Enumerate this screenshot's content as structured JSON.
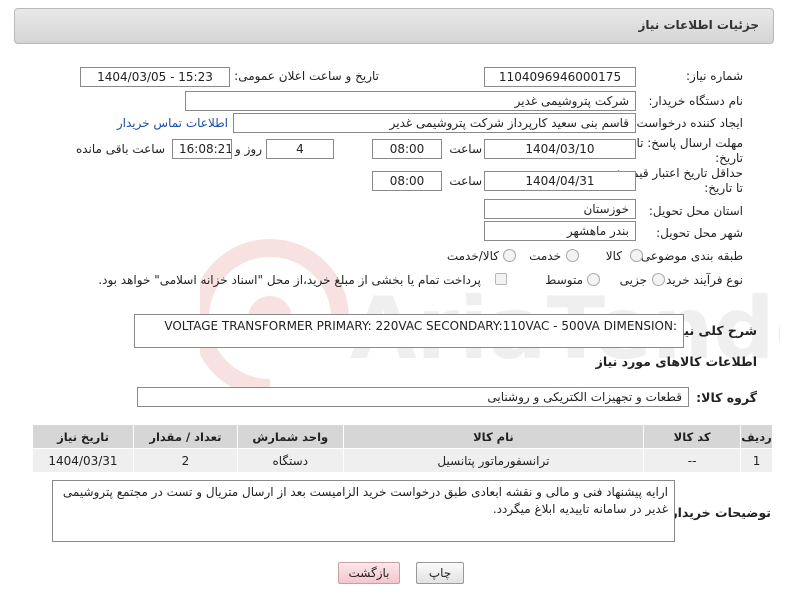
{
  "header": {
    "title": "جزئیات اطلاعات نیاز"
  },
  "form": {
    "need_number": {
      "label": "شماره نیاز:",
      "value": "1104096946000175"
    },
    "announce_datetime": {
      "label": "تاریخ و ساعت اعلان عمومی:",
      "value": "1404/03/05 - 15:23"
    },
    "buyer_org": {
      "label": "نام دستگاه خریدار:",
      "value": "شرکت پتروشیمی غدیر"
    },
    "creator": {
      "label": "ایجاد کننده درخواست:",
      "value": "قاسم بنی سعید کارپرداز شرکت پتروشیمی غدیر",
      "contact_link": "اطلاعات تماس خریدار"
    },
    "reply_deadline": {
      "label": "مهلت ارسال پاسخ: تا تاریخ:",
      "date": "1404/03/10",
      "time_label": "ساعت",
      "time": "08:00",
      "days": "4",
      "days_label": "روز و",
      "remaining_time": "16:08:21",
      "remaining_label": "ساعت باقی مانده"
    },
    "price_validity": {
      "label": "حداقل تاریخ اعتبار قیمت: تا تاریخ:",
      "date": "1404/04/31",
      "time_label": "ساعت",
      "time": "08:00"
    },
    "delivery_province": {
      "label": "استان محل تحویل:",
      "value": "خوزستان"
    },
    "delivery_city": {
      "label": "شهر محل تحویل:",
      "value": "بندر ماهشهر"
    },
    "category": {
      "label": "طبقه بندی موضوعی:",
      "options": [
        "کالا",
        "خدمت",
        "کالا/خدمت"
      ]
    },
    "process_type": {
      "label": "نوع فرآیند خرید :",
      "options": [
        "جزیی",
        "متوسط"
      ],
      "payment_note": "پرداخت تمام یا بخشی از مبلغ خرید،از محل \"اسناد خزانه اسلامی\" خواهد بود."
    },
    "general_desc": {
      "label": "شرح کلی نیاز:",
      "value": "VOLTAGE TRANSFORMER PRIMARY: 220VAC SECONDARY:110VAC - 500VA DIMENSION:"
    }
  },
  "goods": {
    "section_title": "اطلاعات کالاهای مورد نیاز",
    "group_label": "گروه کالا:",
    "group_value": "قطعات و تجهیزات الکتریکی و روشنایی",
    "table": {
      "headers": [
        "ردیف",
        "کد کالا",
        "نام کالا",
        "واحد شمارش",
        "تعداد / مقدار",
        "تاریخ نیاز"
      ],
      "rows": [
        [
          "1",
          "--",
          "ترانسفورماتور پتانسیل",
          "دستگاه",
          "2",
          "1404/03/31"
        ]
      ]
    }
  },
  "buyer_notes": {
    "label": "توضیحات خریدار:",
    "value": "ارایه پیشنهاد فنی و مالی و نقشه ابعادی طبق درخواست خرید الزامیست بعد از ارسال متریال و تست در مجتمع پتروشیمی غدیر در سامانه تاییدیه ابلاغ میگردد."
  },
  "buttons": {
    "print": "چاپ",
    "back": "بازگشت"
  },
  "watermark": {
    "text": "AriaTender.net"
  }
}
